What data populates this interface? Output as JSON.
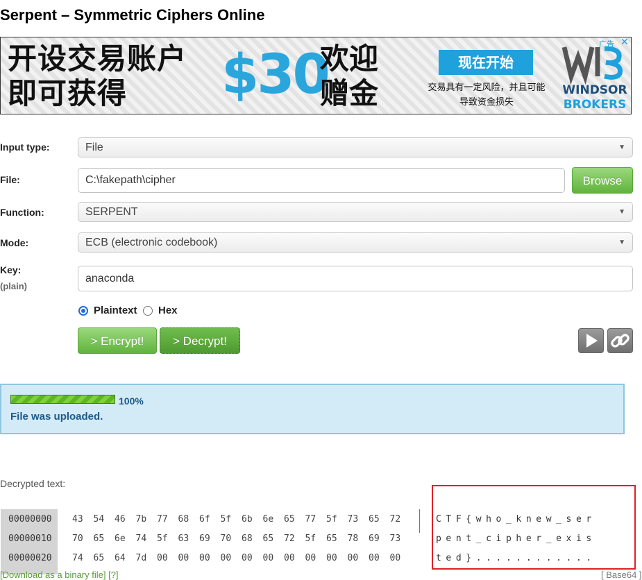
{
  "page": {
    "title": "Serpent – Symmetric Ciphers Online"
  },
  "ad": {
    "line1": "开设交易账户",
    "line2": "即可获得",
    "amount": "$30",
    "bonus_line1": "欢迎",
    "bonus_line2": "赠金",
    "cta": "现在开始",
    "risk_line1": "交易具有一定风险，并且可能",
    "risk_line2": "导致资金损失",
    "brand_line1": "WINDSOR",
    "brand_line2": "BROKERS",
    "ad_mark": "广告",
    "close": "✕"
  },
  "form": {
    "input_type_label": "Input type:",
    "input_type_value": "File",
    "file_label": "File:",
    "file_value": "C:\\fakepath\\cipher",
    "browse_label": "Browse",
    "function_label": "Function:",
    "function_value": "SERPENT",
    "mode_label": "Mode:",
    "mode_value": "ECB (electronic codebook)",
    "key_label": "Key:",
    "key_sublabel": "(plain)",
    "key_value": "anaconda",
    "radio_plaintext": "Plaintext",
    "radio_hex": "Hex",
    "selected_radio": "Plaintext",
    "encrypt_label": "> Encrypt!",
    "decrypt_label": "> Decrypt!"
  },
  "status": {
    "progress_percent": 100,
    "progress_text": "100%",
    "message": "File was uploaded."
  },
  "result": {
    "label": "Decrypted text:",
    "rows": [
      {
        "offset": "00000000",
        "bytes": [
          "43",
          "54",
          "46",
          "7b",
          "77",
          "68",
          "6f",
          "5f",
          "6b",
          "6e",
          "65",
          "77",
          "5f",
          "73",
          "65",
          "72"
        ],
        "ascii": "CTF{who_knew_ser"
      },
      {
        "offset": "00000010",
        "bytes": [
          "70",
          "65",
          "6e",
          "74",
          "5f",
          "63",
          "69",
          "70",
          "68",
          "65",
          "72",
          "5f",
          "65",
          "78",
          "69",
          "73"
        ],
        "ascii": "pent_cipher_exis"
      },
      {
        "offset": "00000020",
        "bytes": [
          "74",
          "65",
          "64",
          "7d",
          "00",
          "00",
          "00",
          "00",
          "00",
          "00",
          "00",
          "00",
          "00",
          "00",
          "00",
          "00"
        ],
        "ascii": "ted}............"
      }
    ],
    "footer_left": "[Download as a binary file] [?]",
    "footer_right": "[ Base64 ]"
  },
  "colors": {
    "accent_blue": "#1ea1dc",
    "green_button": "#61b33e",
    "status_bg": "#d3ebf7",
    "highlight_red": "#e01f25"
  }
}
